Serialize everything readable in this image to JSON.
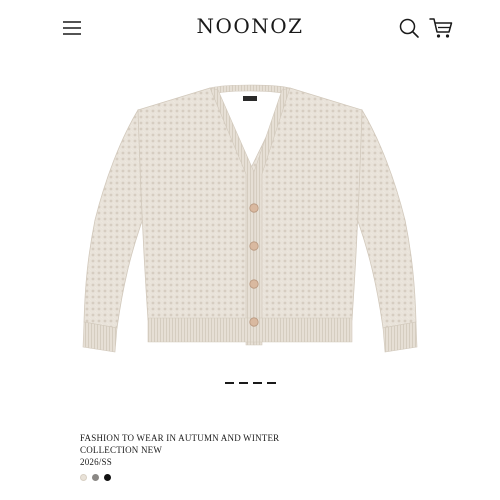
{
  "header": {
    "brand": "NOONOZ",
    "menu_icon": "hamburger-menu-icon",
    "search_icon": "search-icon",
    "cart_icon": "cart-icon"
  },
  "product": {
    "image": "beige-knit-cardigan",
    "title_line1": "FASHION TO WEAR IN AUTUMN AND WINTER",
    "title_line2": "COLLECTION NEW",
    "season": "2026/SS"
  },
  "carousel": {
    "count": 4,
    "current": 1
  },
  "swatches": [
    {
      "name": "cream",
      "color": "#e9e2d8"
    },
    {
      "name": "gray",
      "color": "#8a8784"
    },
    {
      "name": "black",
      "color": "#111111"
    }
  ]
}
